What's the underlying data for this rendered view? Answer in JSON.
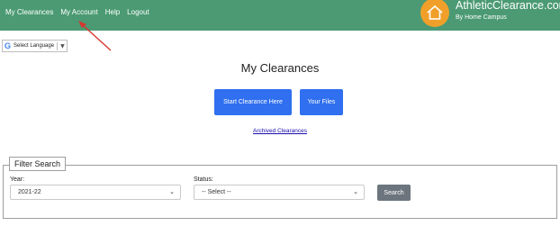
{
  "nav": {
    "items": [
      {
        "label": "My Clearances"
      },
      {
        "label": "My Account"
      },
      {
        "label": "Help"
      },
      {
        "label": "Logout"
      }
    ]
  },
  "brand": {
    "title": "AthleticClearance.com",
    "subtitle": "By Home Campus",
    "logo_icon": "home-icon",
    "colors": {
      "header": "#4b9a73",
      "logo": "#f0a02a"
    }
  },
  "translate": {
    "label": "Select Language",
    "dropdown_glyph": "▼",
    "logo_letter": "G"
  },
  "main": {
    "title": "My Clearances",
    "start_button": "Start Clearance Here",
    "files_button": "Your Files",
    "archived_link": "Archived Clearances",
    "accent_color": "#2f6ff0"
  },
  "filter": {
    "legend": "Filter Search",
    "year": {
      "label": "Year:",
      "value": "2021-22"
    },
    "status": {
      "label": "Status:",
      "value": "-- Select --"
    },
    "search_button": "Search"
  },
  "annotation": {
    "arrow_color": "#d6372e"
  }
}
